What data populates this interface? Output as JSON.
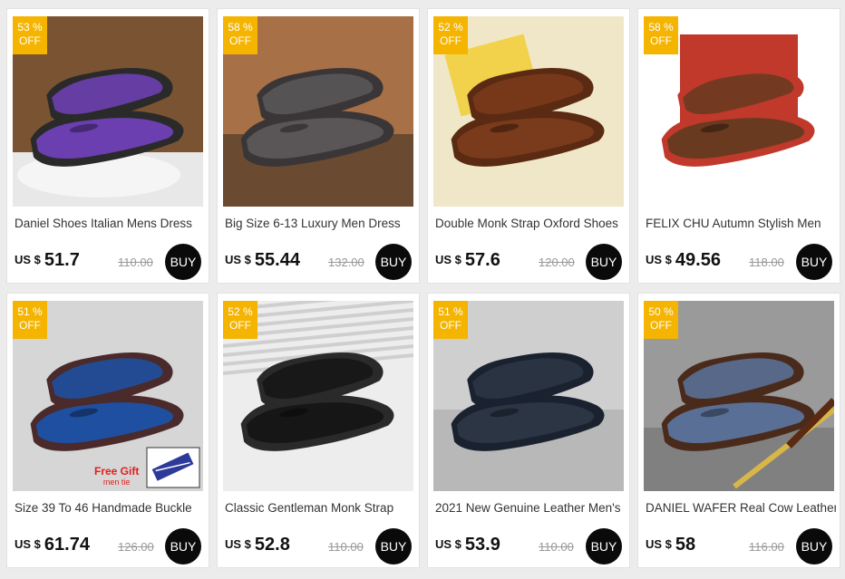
{
  "products": [
    {
      "badge_percent": "53 %",
      "badge_off": "OFF",
      "title": "Daniel Shoes Italian Mens Dress",
      "currency": "US $",
      "price": "51.7",
      "old_price": "110.00",
      "buy": "BUY",
      "bg": "#7a5432",
      "shoe": "#6b3fb0",
      "shoe2": "#2a2a2a",
      "icon": "purple-oxford-shoes-image"
    },
    {
      "badge_percent": "58 %",
      "badge_off": "OFF",
      "title": "Big Size 6-13 Luxury Men Dress",
      "currency": "US $",
      "price": "55.44",
      "old_price": "132.00",
      "buy": "BUY",
      "bg": "#a87046",
      "shoe": "#5a5658",
      "shoe2": "#3a3638",
      "icon": "grey-brogue-shoes-image"
    },
    {
      "badge_percent": "52 %",
      "badge_off": "OFF",
      "title": "Double Monk Strap Oxford Shoes",
      "currency": "US $",
      "price": "57.6",
      "old_price": "120.00",
      "buy": "BUY",
      "bg": "#efe7c8",
      "shoe": "#7a3a1c",
      "shoe2": "#5a2a12",
      "icon": "brown-monk-strap-shoes-image"
    },
    {
      "badge_percent": "58 %",
      "badge_off": "OFF",
      "title": "FELIX CHU Autumn Stylish Men",
      "currency": "US $",
      "price": "49.56",
      "old_price": "118.00",
      "buy": "BUY",
      "bg": "#ffffff",
      "shoe": "#6a3a20",
      "shoe2": "#c0392b",
      "icon": "woven-loafer-shoes-image"
    },
    {
      "badge_percent": "51 %",
      "badge_off": "OFF",
      "title": "Size 39 To 46 Handmade Buckle",
      "currency": "US $",
      "price": "61.74",
      "old_price": "126.00",
      "buy": "BUY",
      "bg": "#d6d6d6",
      "shoe": "#1f4fa0",
      "shoe2": "#4a2a2a",
      "icon": "blue-monk-strap-shoes-image",
      "gift_label": "Free Gift",
      "gift_sub": "men tie"
    },
    {
      "badge_percent": "52 %",
      "badge_off": "OFF",
      "title": "Classic Gentleman Monk Strap",
      "currency": "US $",
      "price": "52.8",
      "old_price": "110.00",
      "buy": "BUY",
      "bg": "#ededed",
      "shoe": "#161616",
      "shoe2": "#2a2a2a",
      "icon": "black-monk-strap-shoes-image"
    },
    {
      "badge_percent": "51 %",
      "badge_off": "OFF",
      "title": "2021 New Genuine Leather Men's",
      "currency": "US $",
      "price": "53.9",
      "old_price": "110.00",
      "buy": "BUY",
      "bg": "#cfcfcf",
      "shoe": "#2b3544",
      "shoe2": "#1a2230",
      "icon": "navy-oxford-shoes-image"
    },
    {
      "badge_percent": "50 %",
      "badge_off": "OFF",
      "title": "DANIEL WAFER Real Cow Leather",
      "currency": "US $",
      "price": "58",
      "old_price": "116.00",
      "buy": "BUY",
      "bg": "#9a9a9a",
      "shoe": "#5a6f96",
      "shoe2": "#4a2a1a",
      "icon": "python-pattern-oxford-shoes-image"
    }
  ],
  "colors": {
    "badge": "#f4b400",
    "buy_button": "#0a0a0a",
    "page_bg": "#ececec"
  }
}
